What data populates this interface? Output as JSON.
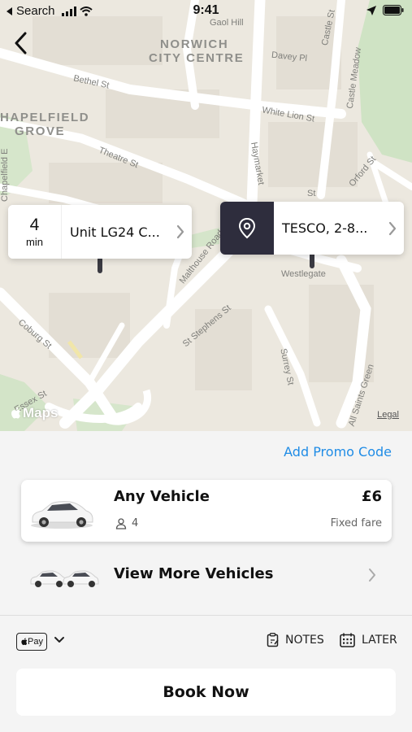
{
  "status_bar": {
    "back_app": "Search",
    "time": "9:41"
  },
  "map": {
    "area_labels": [
      "NORWICH",
      "CITY CENTRE",
      "HAPELFIELD",
      "GROVE"
    ],
    "streets": {
      "gaol_hill": "Gaol Hill",
      "davey_pl": "Davey Pl",
      "castle_st": "Castle St",
      "castle_meadow": "Castle Meadow",
      "bethel_st": "Bethel St",
      "white_lion_st": "White Lion St",
      "theatre_st": "Theatre St",
      "haymarket": "Haymarket",
      "orford_st": "Orford St",
      "malthouse_road": "Malthouse Road",
      "westlegate": "Westlegate",
      "st_stephens_st": "St Stephens St",
      "coburg_st": "Coburg St",
      "surrey_st": "Surrey St",
      "all_saints_green": "All Saints Green",
      "chapelfield_e": "Chapelfield E",
      "essex_st": "Essex St",
      "st": "St"
    },
    "maps_logo": "Maps",
    "legal": "Legal"
  },
  "pickup": {
    "eta_value": "4",
    "eta_unit": "min",
    "address": "Unit LG24 C..."
  },
  "dropoff": {
    "address": "TESCO, 2-8..."
  },
  "sheet": {
    "promo": "Add Promo Code",
    "vehicle": {
      "name": "Any Vehicle",
      "seats": "4",
      "price": "£6",
      "fare_type": "Fixed fare"
    },
    "more_vehicles": "View More Vehicles",
    "payment": "Pay",
    "notes": "NOTES",
    "later": "LATER",
    "book": "Book Now"
  },
  "colors": {
    "accent": "#1f8ce6",
    "map_bg": "#ece8df",
    "dropoff_pin": "#2e2d3d",
    "park": "#cfe3c4"
  }
}
